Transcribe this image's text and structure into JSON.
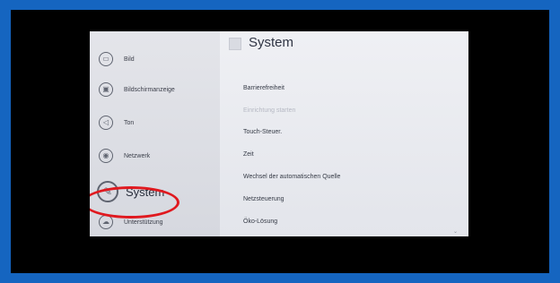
{
  "sidebar": {
    "items": [
      {
        "label": "Bild",
        "icon": "picture-icon"
      },
      {
        "label": "Bildschirmanzeige",
        "icon": "display-icon"
      },
      {
        "label": "Ton",
        "icon": "speaker-icon"
      },
      {
        "label": "Netzwerk",
        "icon": "network-icon"
      },
      {
        "label": "System",
        "icon": "wrench-icon",
        "active": true
      },
      {
        "label": "Unterstützung",
        "icon": "support-icon"
      }
    ]
  },
  "content": {
    "title": "System",
    "items": [
      {
        "label": "Barrierefreiheit"
      },
      {
        "label": "Einrichtung starten",
        "disabled": true
      },
      {
        "label": "Touch-Steuer."
      },
      {
        "label": "Zeit"
      },
      {
        "label": "Wechsel der automatischen Quelle"
      },
      {
        "label": "Netzsteuerung"
      },
      {
        "label": "Öko-Lösung"
      }
    ]
  },
  "colors": {
    "frame": "#1565c0",
    "highlight_ring": "#e0191f"
  }
}
